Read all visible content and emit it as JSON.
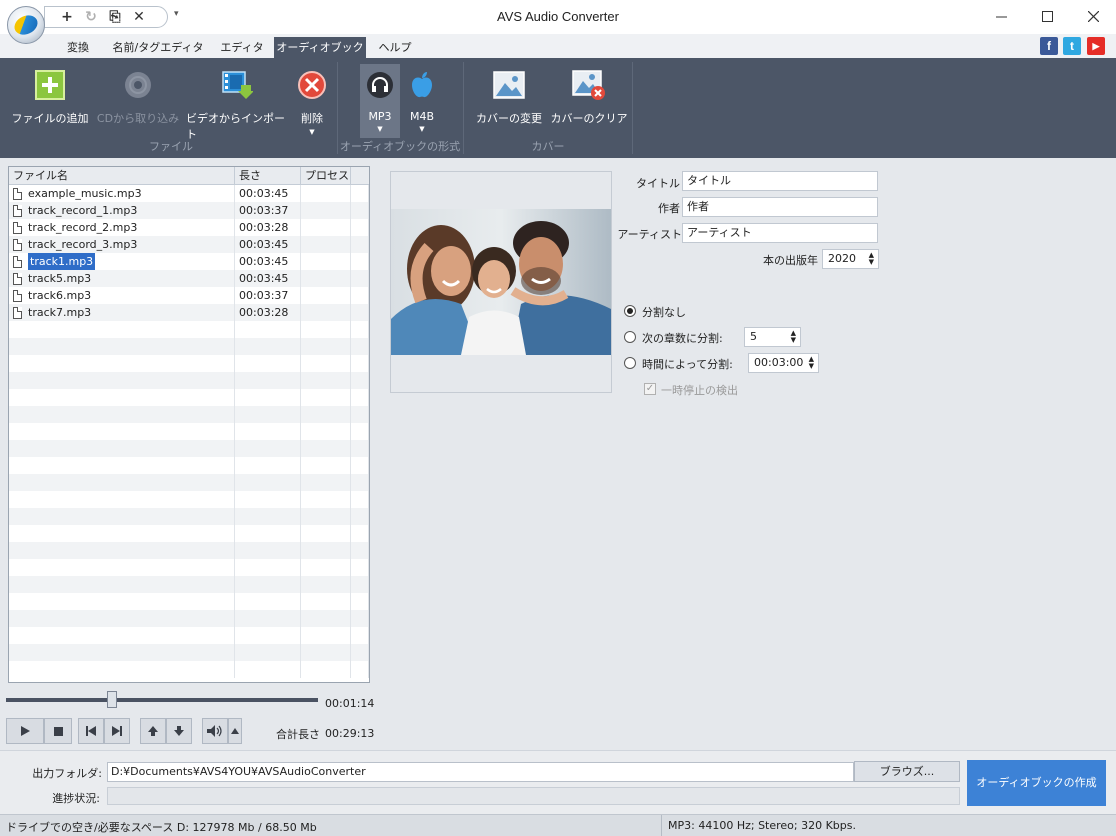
{
  "window": {
    "title": "AVS Audio Converter"
  },
  "qat": {
    "add": "+",
    "refresh": "↻",
    "doc": "⎘",
    "close": "✕",
    "dropdown": "▾"
  },
  "menu": {
    "tabs": [
      "変換",
      "名前/タグエディタ",
      "エディタ",
      "オーディオブック",
      "ヘルプ"
    ],
    "active_index": 3
  },
  "social": {
    "facebook": "f",
    "twitter": "t",
    "youtube": "▶"
  },
  "ribbon": {
    "add_files": "ファイルの追加",
    "cd_rip": "CDから取り込み",
    "import_video": "ビデオからインポート",
    "delete": "削除",
    "mp3": "MP3",
    "m4b": "M4B",
    "change_cover": "カバーの変更",
    "clear_cover": "カバーのクリア",
    "group_file": "ファイル",
    "group_format": "オーディオブックの形式",
    "group_cover": "カバー"
  },
  "filelist": {
    "columns": [
      "ファイル名",
      "長さ",
      "プロセス"
    ],
    "rows": [
      {
        "name": "example_music.mp3",
        "length": "00:03:45"
      },
      {
        "name": "track_record_1.mp3",
        "length": "00:03:37"
      },
      {
        "name": "track_record_2.mp3",
        "length": "00:03:28"
      },
      {
        "name": "track_record_3.mp3",
        "length": "00:03:45"
      },
      {
        "name": "track1.mp3",
        "length": "00:03:45"
      },
      {
        "name": "track5.mp3",
        "length": "00:03:45"
      },
      {
        "name": "track6.mp3",
        "length": "00:03:37"
      },
      {
        "name": "track7.mp3",
        "length": "00:03:28"
      }
    ],
    "selected_index": 4
  },
  "player": {
    "position_fraction": 0.34,
    "current_time": "00:01:14",
    "total_label": "合計長さ",
    "total_value": "00:29:13"
  },
  "metadata": {
    "title_label": "タイトル",
    "title_value": "タイトル",
    "author_label": "作者",
    "author_value": "作者",
    "artist_label": "アーティスト",
    "artist_value": "アーティスト",
    "year_label": "本の出版年",
    "year_value": "2020"
  },
  "split": {
    "none_label": "分割なし",
    "by_chapters_label": "次の章数に分割:",
    "chapters_value": "5",
    "by_time_label": "時間によって分割:",
    "time_value": "00:03:00",
    "pause_detect_label": "一時停止の検出",
    "selected": "none"
  },
  "output": {
    "folder_label": "出力フォルダ:",
    "folder_value": "D:¥Documents¥AVS4YOU¥AVSAudioConverter",
    "browse_label": "ブラウズ...",
    "progress_label": "進捗状況:",
    "progress_fraction": 0,
    "create_label": "オーディオブックの作成"
  },
  "status": {
    "left": "ドライブでの空き/必要なスペース D: 127978 Mb / 68.50 Mb",
    "right": "MP3: 44100  Hz; Stereo; 320 Kbps."
  },
  "colors": {
    "ribbon_bg": "#4c5667",
    "accent_button": "#3d82d6",
    "selection": "#2f6dc8"
  }
}
